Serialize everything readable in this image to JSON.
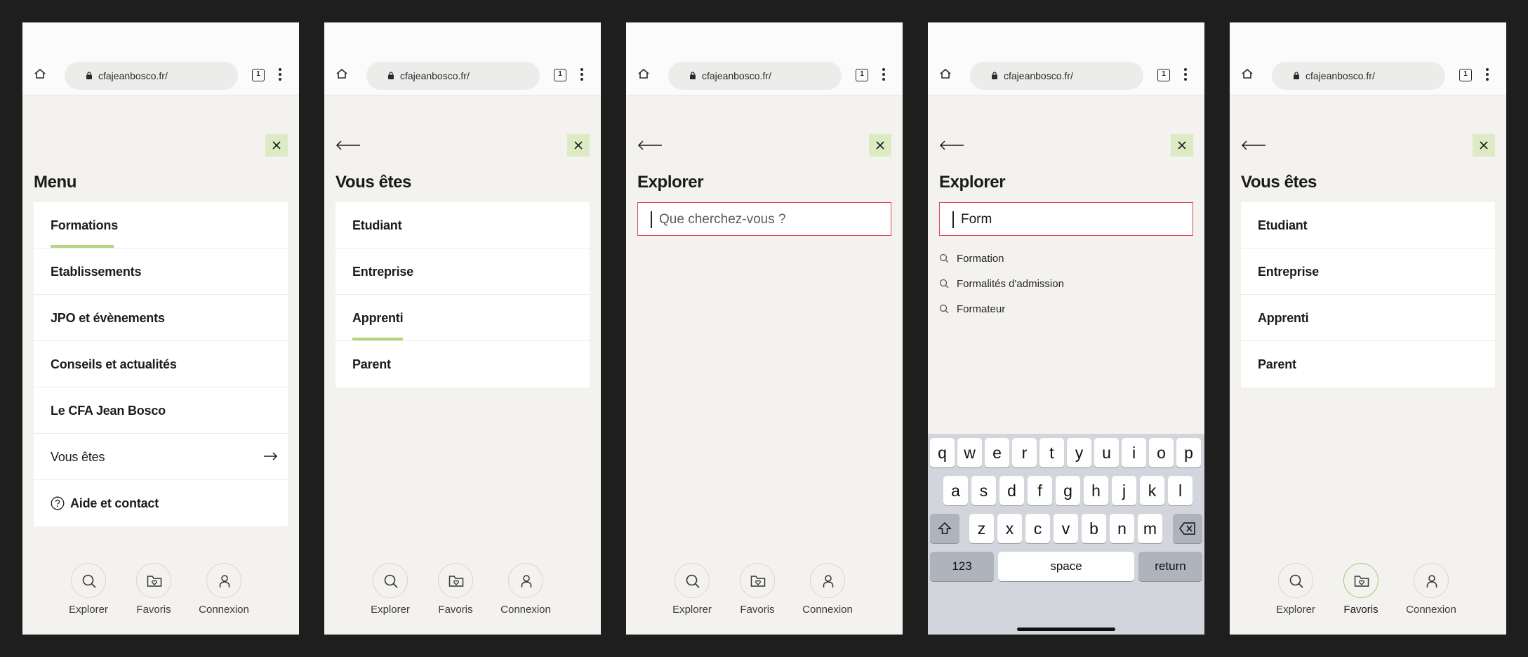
{
  "browser": {
    "url": "cfajeanbosco.fr/",
    "tab_count": "1"
  },
  "colors": {
    "accent_green": "#b8d47e",
    "close_bg": "#dcebc3",
    "search_border": "#d9495c",
    "background": "#f3f2ee"
  },
  "nav": {
    "explore": "Explorer",
    "favorites": "Favoris",
    "login": "Connexion"
  },
  "screen1": {
    "title": "Menu",
    "items": [
      "Formations",
      "Etablissements",
      "JPO et évènements",
      "Conseils et actualités",
      "Le CFA Jean Bosco",
      "Vous êtes",
      "Aide et contact"
    ],
    "active_index": 0
  },
  "screen2": {
    "title": "Vous êtes",
    "items": [
      "Etudiant",
      "Entreprise",
      "Apprenti",
      "Parent"
    ],
    "active_index": 2
  },
  "screen3": {
    "title": "Explorer",
    "search_placeholder": "Que cherchez-vous ?"
  },
  "screen4": {
    "title": "Explorer",
    "search_value": "Form",
    "suggestions": [
      "Formation",
      "Formalités d'admission",
      "Formateur"
    ],
    "keyboard": {
      "row1": [
        "q",
        "w",
        "e",
        "r",
        "t",
        "y",
        "u",
        "i",
        "o",
        "p"
      ],
      "row2": [
        "a",
        "s",
        "d",
        "f",
        "g",
        "h",
        "j",
        "k",
        "l"
      ],
      "row3": [
        "z",
        "x",
        "c",
        "v",
        "b",
        "n",
        "m"
      ],
      "numbers": "123",
      "space": "space",
      "return": "return"
    }
  },
  "screen5": {
    "title": "Vous êtes",
    "items": [
      "Etudiant",
      "Entreprise",
      "Apprenti",
      "Parent"
    ],
    "active_nav": "favorites"
  }
}
